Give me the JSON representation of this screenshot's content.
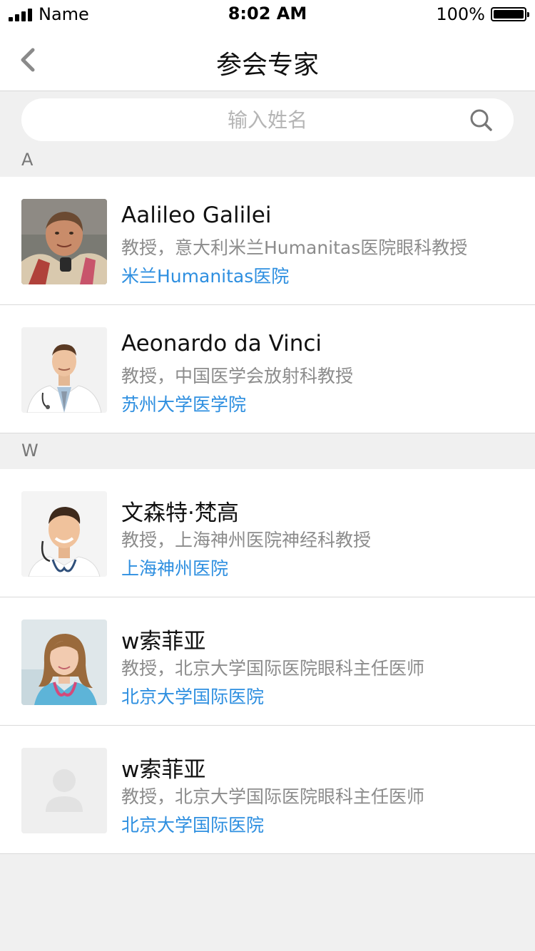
{
  "status_bar": {
    "carrier": "Name",
    "time": "8:02 AM",
    "battery": "100%"
  },
  "nav": {
    "title": "参会专家"
  },
  "search": {
    "placeholder": "输入姓名"
  },
  "sections": [
    {
      "letter": "A",
      "experts": [
        {
          "name": "Aalileo Galilei",
          "title": "教授，意大利米兰Humanitas医院眼科教授",
          "hospital": "米兰Humanitas医院"
        },
        {
          "name": "Aeonardo da Vinci",
          "title": "教授，中国医学会放射科教授",
          "hospital": "苏州大学医学院"
        }
      ]
    },
    {
      "letter": "W",
      "experts": [
        {
          "name": "文森特·梵高",
          "title": "教授，上海神州医院神经科教授",
          "hospital": "上海神州医院"
        },
        {
          "name": "w索菲亚",
          "title": "教授，北京大学国际医院眼科主任医师",
          "hospital": "北京大学国际医院"
        },
        {
          "name": "w索菲亚",
          "title": "教授，北京大学国际医院眼科主任医师",
          "hospital": "北京大学国际医院"
        }
      ]
    }
  ],
  "colors": {
    "link": "#2e8fe0",
    "secondary_text": "#8c8c8c",
    "background": "#f0f0f0"
  }
}
